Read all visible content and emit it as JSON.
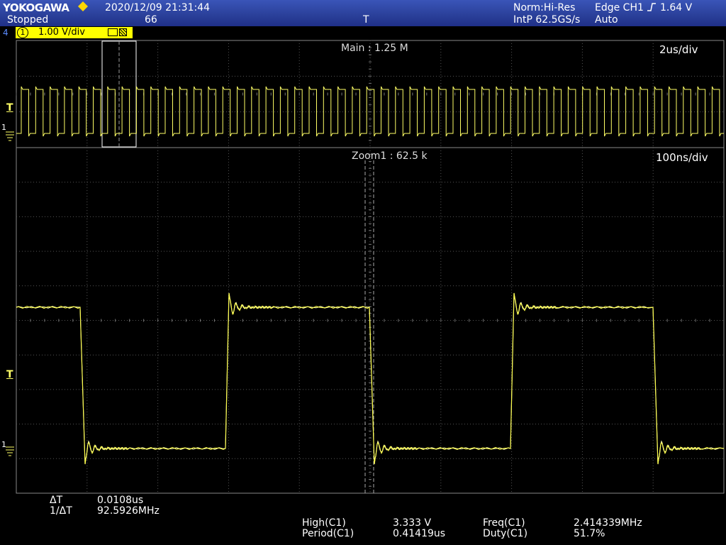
{
  "header": {
    "brand": "YOKOGAWA",
    "status": "Stopped",
    "datetime": "2020/12/09 21:31:44",
    "acq_count": "66",
    "acq_mode": "Norm:Hi-Res",
    "sample_rate": "IntP 62.5GS/s",
    "trigger": "Edge CH1",
    "trigger_level": "1.64 V",
    "trigger_mode": "Auto",
    "trigger_pos_marker": "T"
  },
  "channel": {
    "number": "4",
    "id": "1",
    "scale": "1.00 V/div"
  },
  "main_panel": {
    "record_label": "Main : 1.25 M",
    "timebase": "2us/div",
    "trigger_marker": "T",
    "ch_marker": "1"
  },
  "zoom_panel": {
    "record_label": "Zoom1 : 62.5 k",
    "timebase": "100ns/div",
    "trigger_marker": "T",
    "ch_marker": "1"
  },
  "cursor": {
    "dt_label": "ΔT",
    "dt_value": "0.0108us",
    "inv_label": "1/ΔT",
    "inv_value": "92.5926MHz"
  },
  "measurements": [
    {
      "label": "High(C1)",
      "value": "3.333 V"
    },
    {
      "label": "Period(C1)",
      "value": "0.41419us"
    },
    {
      "label": "Freq(C1)",
      "value": "2.414339MHz"
    },
    {
      "label": "Duty(C1)",
      "value": "51.7%"
    }
  ],
  "colors": {
    "trace": "#ffff66",
    "header_bg": "#2a3f99",
    "channel_bg": "#ffff00",
    "grid": "#555555"
  }
}
